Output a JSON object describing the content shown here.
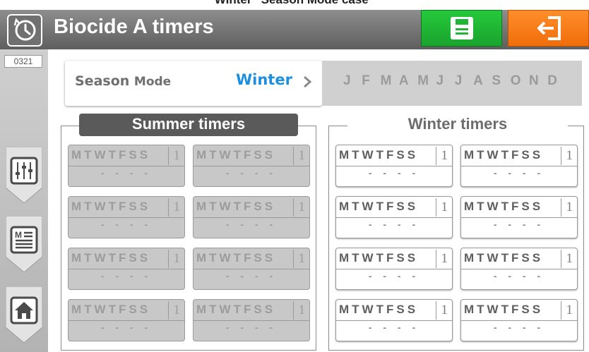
{
  "caption": "Winter “Season Mode case”",
  "header": {
    "title": "Biocide A timers",
    "app_icon": "clock-icon",
    "save_icon": "save-icon",
    "exit_icon": "exit-icon"
  },
  "sidebar": {
    "code": "0321",
    "tabs": [
      {
        "name": "settings",
        "icon": "sliders-icon"
      },
      {
        "name": "menu",
        "icon": "menu-list-icon"
      },
      {
        "name": "home",
        "icon": "home-icon"
      }
    ]
  },
  "season": {
    "label": "Season",
    "label_sub": "Mode",
    "value": "Winter",
    "months": [
      "J",
      "F",
      "M",
      "A",
      "M",
      "J",
      "J",
      "A",
      "S",
      "O",
      "N",
      "D"
    ]
  },
  "summer": {
    "title": "Summer timers",
    "timers": [
      {
        "days": "MTWTFSS",
        "num": "1",
        "time": "- - - -"
      },
      {
        "days": "MTWTFSS",
        "num": "1",
        "time": "- - - -"
      },
      {
        "days": "MTWTFSS",
        "num": "1",
        "time": "- - - -"
      },
      {
        "days": "MTWTFSS",
        "num": "1",
        "time": "- - - -"
      },
      {
        "days": "MTWTFSS",
        "num": "1",
        "time": "- - - -"
      },
      {
        "days": "MTWTFSS",
        "num": "1",
        "time": "- - - -"
      },
      {
        "days": "MTWTFSS",
        "num": "1",
        "time": "- - - -"
      },
      {
        "days": "MTWTFSS",
        "num": "1",
        "time": "- - - -"
      }
    ]
  },
  "winter": {
    "title": "Winter timers",
    "timers": [
      {
        "days": "MTWTFSS",
        "num": "1",
        "time": "- - - -"
      },
      {
        "days": "MTWTFSS",
        "num": "1",
        "time": "- - - -"
      },
      {
        "days": "MTWTFSS",
        "num": "1",
        "time": "- - - -"
      },
      {
        "days": "MTWTFSS",
        "num": "1",
        "time": "- - - -"
      },
      {
        "days": "MTWTFSS",
        "num": "1",
        "time": "- - - -"
      },
      {
        "days": "MTWTFSS",
        "num": "1",
        "time": "- - - -"
      },
      {
        "days": "MTWTFSS",
        "num": "1",
        "time": "- - - -"
      },
      {
        "days": "MTWTFSS",
        "num": "1",
        "time": "- - - -"
      }
    ]
  },
  "colors": {
    "save": "#22c13a",
    "exit": "#f57a15",
    "accent_blue": "#1c8fe0"
  }
}
